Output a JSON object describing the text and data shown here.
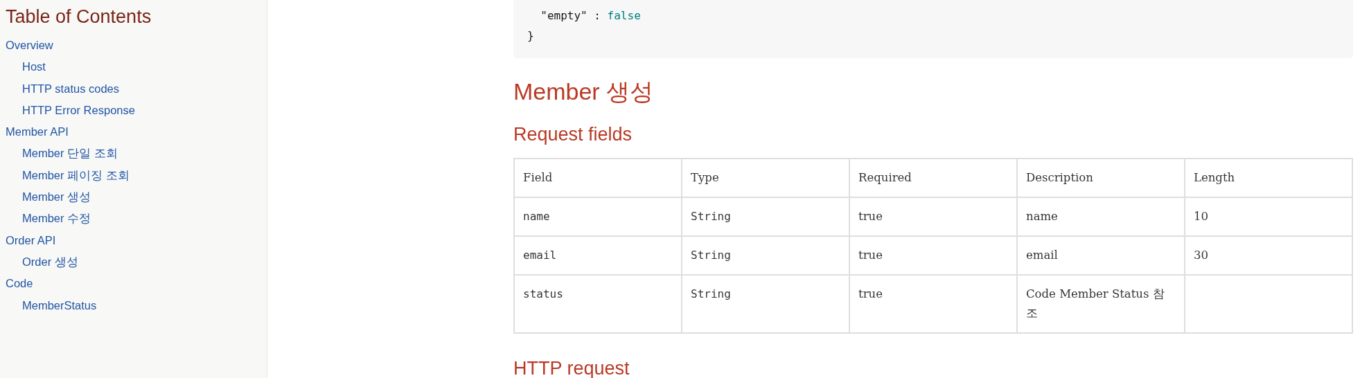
{
  "sidebar": {
    "title": "Table of Contents",
    "items": [
      {
        "label": "Overview",
        "children": [
          {
            "label": "Host"
          },
          {
            "label": "HTTP status codes"
          },
          {
            "label": "HTTP Error Response"
          }
        ]
      },
      {
        "label": "Member API",
        "children": [
          {
            "label": "Member 단일 조회"
          },
          {
            "label": "Member 페이징 조회"
          },
          {
            "label": "Member 생성"
          },
          {
            "label": "Member 수정"
          }
        ]
      },
      {
        "label": "Order API",
        "children": [
          {
            "label": "Order 생성"
          }
        ]
      },
      {
        "label": "Code",
        "children": [
          {
            "label": "MemberStatus"
          }
        ]
      }
    ]
  },
  "code_block": {
    "lines": [
      {
        "key": "  \"empty\" : ",
        "value": "false"
      },
      {
        "key": "}"
      }
    ]
  },
  "section_title": "Member 생성",
  "subsection_title": "Request fields",
  "table": {
    "columns": [
      {
        "label": "Field",
        "kind": "code"
      },
      {
        "label": "Type",
        "kind": "code"
      },
      {
        "label": "Required",
        "kind": "text"
      },
      {
        "label": "Description",
        "kind": "text"
      },
      {
        "label": "Length",
        "kind": "text"
      }
    ],
    "rows": [
      [
        "name",
        "String",
        "true",
        "name",
        "10"
      ],
      [
        "email",
        "String",
        "true",
        "email",
        "30"
      ],
      [
        "status",
        "String",
        "true",
        "Code Member Status 참조",
        ""
      ]
    ]
  },
  "next_title": "HTTP request"
}
